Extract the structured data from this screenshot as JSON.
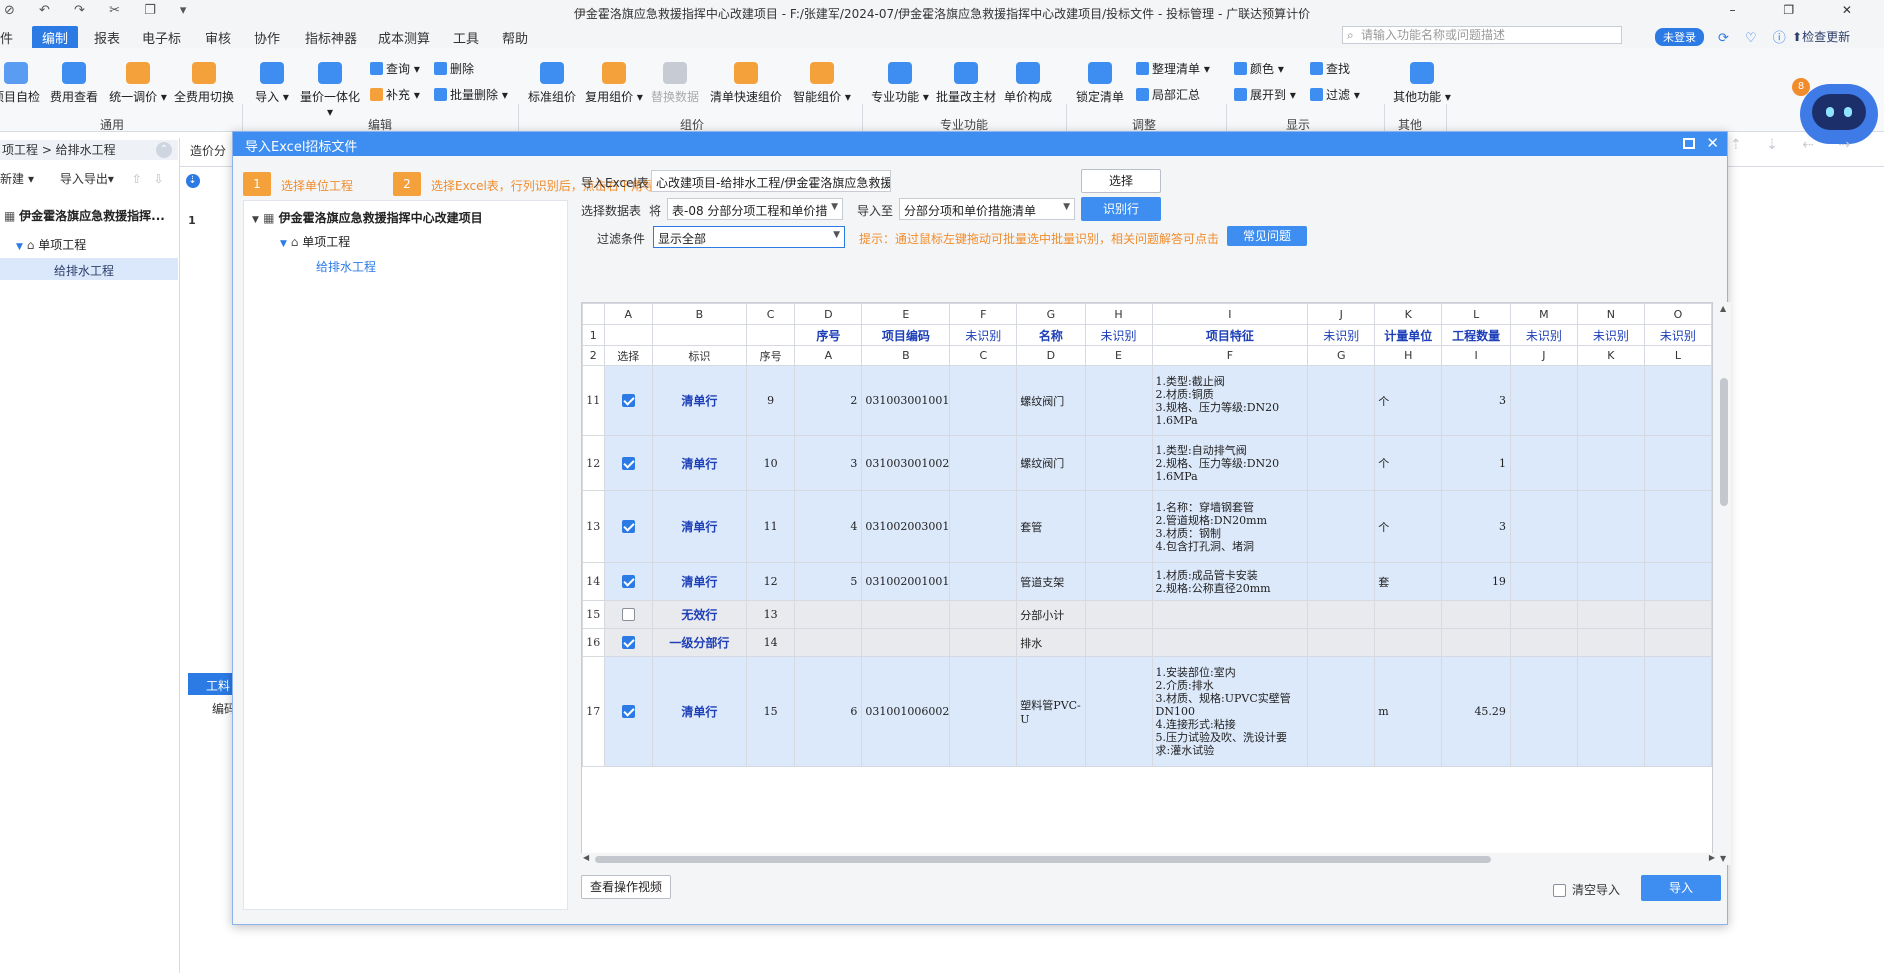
{
  "window": {
    "title": "伊金霍洛旗应急救援指挥中心改建项目 - F:/张建军/2024-07/伊金霍洛旗应急救援指挥中心改建项目/投标文件 - 投标管理 - 广联达预算计价",
    "quick_access": "⊘ ↶ ↷ ✂ ❐ ▾"
  },
  "menu": {
    "items": [
      "件",
      "编制",
      "报表",
      "电子标",
      "审核",
      "协作",
      "指标神器",
      "成本测算",
      "工具",
      "帮助"
    ],
    "search_placeholder": "请输入功能名称或问题描述",
    "login": "未登录",
    "check_update": "检查更新"
  },
  "ribbon": {
    "buttons": [
      "项目自检",
      "费用查看",
      "统一调价",
      "全费用切换",
      "导入",
      "量价一体化",
      "标准组价",
      "复用组价",
      "替换数据",
      "清单快速组价",
      "智能组价",
      "专业功能",
      "批量改主材",
      "单价构成",
      "锁定清单",
      "其他功能"
    ],
    "small": [
      "查询",
      "删除",
      "补充",
      "批量删除",
      "整理清单",
      "局部汇总",
      "颜色",
      "查找",
      "展开到",
      "过滤"
    ],
    "groups": [
      "通用",
      "编辑",
      "组价",
      "专业功能",
      "调整",
      "显示",
      "其他"
    ]
  },
  "left_panel": {
    "breadcrumb": "项工程 > 给排水工程",
    "tools": [
      "新建",
      "导入导出"
    ],
    "tree": [
      "伊金霍洛旗应急救援指挥...",
      "单项工程",
      "给排水工程"
    ]
  },
  "background": {
    "tab": "造价分",
    "bottom_tab": "工料",
    "bottom_label": "编码",
    "row1": "1"
  },
  "robot_badge": "8",
  "dialog": {
    "title": "导入Excel招标文件",
    "steps": [
      {
        "num": "1",
        "label": "选择单位工程"
      },
      {
        "num": "2",
        "label": "选择Excel表，行列识别后，点击右下角导入按钮"
      }
    ],
    "tree": {
      "root": "伊金霍洛旗应急救援指挥中心改建项目",
      "child": "单项工程",
      "leaf": "给排水工程"
    },
    "import_excel_label": "导入Excel表",
    "import_excel_path": "心改建项目-给排水工程/伊金霍洛旗应急救援指挥中心改建项目-给排水工程.xlsx",
    "select_button": "选择",
    "select_sheet_label": "选择数据表",
    "will_label": "将",
    "sheet_value": "表-08 分部分项工程和单价措",
    "import_to_label": "导入至",
    "import_to_value": "分部分项和单价措施清单",
    "identify_button": "识别行",
    "filter_label": "过滤条件",
    "filter_value": "显示全部",
    "hint": "提示：通过鼠标左键拖动可批量选中批量识别，相关问题解答可点击",
    "faq_button": "常见问题",
    "view_video_button": "查看操作视频",
    "clear_import_label": "清空导入",
    "import_button": "导入"
  },
  "grid": {
    "col_letters": [
      "A",
      "B",
      "C",
      "D",
      "E",
      "F",
      "G",
      "H",
      "I",
      "J",
      "K",
      "L",
      "M",
      "N",
      "O"
    ],
    "row1": [
      "",
      "",
      "",
      "序号",
      "项目编码",
      "未识别",
      "名称",
      "未识别",
      "项目特征",
      "未识别",
      "计量单位",
      "工程数量",
      "未识别",
      "未识别",
      "未识别"
    ],
    "row2": [
      "选择",
      "标识",
      "序号",
      "A",
      "B",
      "C",
      "D",
      "E",
      "F",
      "G",
      "H",
      "I",
      "J",
      "K",
      "L"
    ],
    "rows": [
      {
        "rn": "11",
        "checked": true,
        "mark": "清单行",
        "seq": "9",
        "d": "2",
        "code": "031003001001",
        "f": "",
        "name": "螺纹阀门",
        "h": "",
        "feat": "1.类型:截止阀\n2.材质:铜质\n3.规格、压力等级:DN20\n1.6MPa",
        "j": "",
        "unit": "个",
        "qty": "3",
        "style": "blue"
      },
      {
        "rn": "12",
        "checked": true,
        "mark": "清单行",
        "seq": "10",
        "d": "3",
        "code": "031003001002",
        "f": "",
        "name": "螺纹阀门",
        "h": "",
        "feat": "1.类型:自动排气阀\n2.规格、压力等级:DN20\n1.6MPa",
        "j": "",
        "unit": "个",
        "qty": "1",
        "style": "blue"
      },
      {
        "rn": "13",
        "checked": true,
        "mark": "清单行",
        "seq": "11",
        "d": "4",
        "code": "031002003001",
        "f": "",
        "name": "套管",
        "h": "",
        "feat": "1.名称：穿墙钢套管\n2.管道规格:DN20mm\n3.材质：钢制\n4.包含打孔洞、堵洞",
        "j": "",
        "unit": "个",
        "qty": "3",
        "style": "blue"
      },
      {
        "rn": "14",
        "checked": true,
        "mark": "清单行",
        "seq": "12",
        "d": "5",
        "code": "031002001001",
        "f": "",
        "name": "管道支架",
        "h": "",
        "feat": "1.材质:成品管卡安装\n2.规格:公称直径20mm",
        "j": "",
        "unit": "套",
        "qty": "19",
        "style": "blue"
      },
      {
        "rn": "15",
        "checked": false,
        "mark": "无效行",
        "seq": "13",
        "d": "",
        "code": "",
        "f": "",
        "name": "分部小计",
        "h": "",
        "feat": "",
        "j": "",
        "unit": "",
        "qty": "",
        "style": "gray"
      },
      {
        "rn": "16",
        "checked": true,
        "mark": "一级分部行",
        "seq": "14",
        "d": "",
        "code": "",
        "f": "",
        "name": "排水",
        "h": "",
        "feat": "",
        "j": "",
        "unit": "",
        "qty": "",
        "style": "gray"
      },
      {
        "rn": "17",
        "checked": true,
        "mark": "清单行",
        "seq": "15",
        "d": "6",
        "code": "031001006002",
        "f": "",
        "name": "塑料管PVC-U",
        "h": "",
        "feat": "1.安装部位:室内\n2.介质:排水\n3.材质、规格:UPVC实壁管\nDN100\n4.连接形式:粘接\n5.压力试验及吹、洗设计要\n求:灌水试验",
        "j": "",
        "unit": "m",
        "qty": "45.29",
        "style": "blue"
      }
    ]
  },
  "colors": {
    "accent": "#3d8ef0",
    "orange": "#f5a13b",
    "row_blue": "#dce9fb",
    "row_gray": "#e9eaed",
    "header_text": "#1d3fb8"
  }
}
